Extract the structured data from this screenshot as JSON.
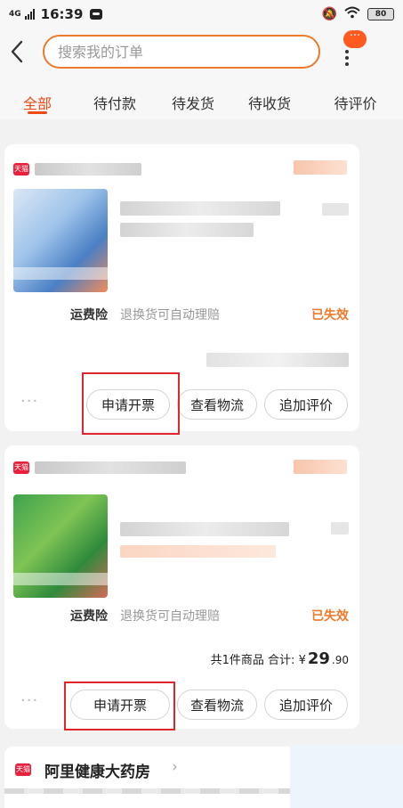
{
  "status_bar": {
    "signal_label": "4G",
    "time": "16:39",
    "battery": "80"
  },
  "header": {
    "search_placeholder": "搜索我的订单",
    "badge": "···"
  },
  "tabs": [
    {
      "label": "全部",
      "active": true
    },
    {
      "label": "待付款",
      "active": false
    },
    {
      "label": "待发货",
      "active": false
    },
    {
      "label": "待收货",
      "active": false
    },
    {
      "label": "待评价",
      "active": false
    }
  ],
  "orders": [
    {
      "shop_badge": "天猫",
      "service_freight": "运费险",
      "service_refund": "退换货可自动理赔",
      "status": "已失效",
      "more": "···",
      "actions": [
        "申请开票",
        "查看物流",
        "追加评价"
      ]
    },
    {
      "shop_badge": "天猫",
      "service_freight": "运费险",
      "service_refund": "退换货可自动理赔",
      "status": "已失效",
      "total_label": "共1件商品 合计: ¥",
      "total_int": "29",
      "total_cents": ".90",
      "more": "···",
      "actions": [
        "申请开票",
        "查看物流",
        "追加评价"
      ]
    }
  ],
  "shop3": {
    "badge": "天猫",
    "name": "阿里健康大药房",
    "chevron": "›"
  },
  "colors": {
    "accent": "#f04a14",
    "search_border": "#f07a2c",
    "highlight": "#e0262b",
    "tmall": "#e8203c"
  }
}
